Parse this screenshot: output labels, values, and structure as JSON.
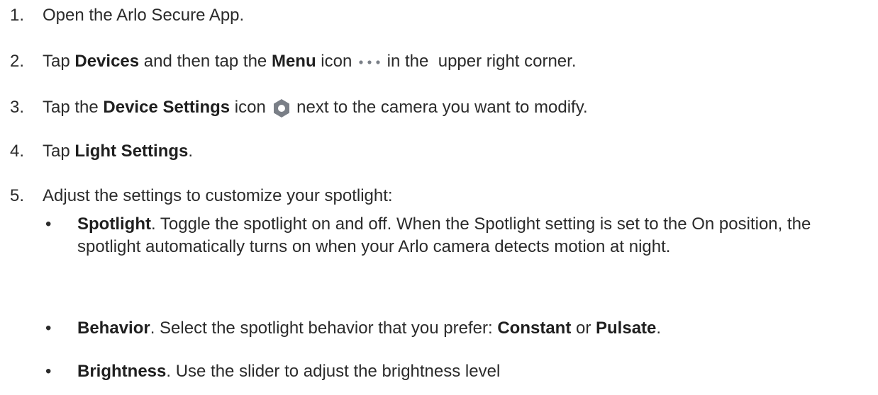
{
  "steps": [
    {
      "num": "1.",
      "text": "Open the Arlo Secure App."
    },
    {
      "num": "2.",
      "t1": "Tap ",
      "b1": "Devices",
      "t2": " and then tap the ",
      "b2": "Menu",
      "t3": " icon ",
      "icon": "more-horizontal-icon",
      "t4": " in the  upper right corner."
    },
    {
      "num": "3.",
      "t1": "Tap the ",
      "b1": "Device Settings",
      "t2": " icon ",
      "icon": "gear-icon",
      "t3": " next to the camera you want to modify."
    },
    {
      "num": "4.",
      "t1": "Tap ",
      "b1": "Light Settings",
      "t2": "."
    },
    {
      "num": "5.",
      "text": "Adjust the settings to customize your spotlight:"
    }
  ],
  "bullets": [
    {
      "b": "Spotlight",
      "text": ". Toggle the spotlight on and off. When the Spotlight setting is set to the On position, the spotlight automatically turns on when your Arlo camera detects motion at night."
    },
    {
      "b": "Behavior",
      "t1": ". Select the spotlight behavior that you prefer: ",
      "b2": "Constant",
      "t2": " or ",
      "b3": "Pulsate",
      "t3": "."
    },
    {
      "b": "Brightness",
      "text": ". Use the slider to adjust the brightness level"
    }
  ],
  "bullet_char": "•",
  "icon_color": "#7a7f87"
}
